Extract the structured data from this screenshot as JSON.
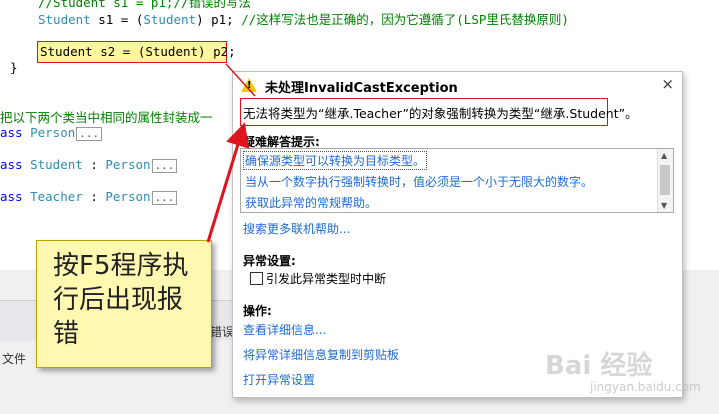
{
  "editor": {
    "line1": {
      "comment": "//Student s1 = p1;//错误的写法"
    },
    "line2": {
      "type1": "Student",
      "mid1": " s1 = (",
      "type2": "Student",
      "mid2": ") p1; ",
      "comment": "//这样写法也是正确的，因为它遵循了(LSP里氏替换原则)"
    },
    "line3": {
      "text": "Student s2 = (Student) p2;"
    },
    "brace": "}",
    "comment_line": "把以下两个类当中相同的属性封装成一",
    "class_person": {
      "kw": "ass",
      "name": "Person",
      "collapsed": "..."
    },
    "class_student": {
      "kw": "ass",
      "name": "Student",
      "sep": " : ",
      "base": "Person",
      "collapsed": "..."
    },
    "class_teacher": {
      "kw": "ass",
      "name": "Teacher",
      "sep": " : ",
      "base": "Person",
      "collapsed": "..."
    }
  },
  "lower_panel": {
    "tab_file": "文件",
    "tab_partial": "错误"
  },
  "exception_popup": {
    "title": "未处理InvalidCastException",
    "close_icon": "×",
    "message": "无法将类型为“继承.Teacher”的对象强制转换为类型“继承.Student”。",
    "tips_label": "疑难解答提示:",
    "tips": [
      "确保源类型可以转换为目标类型。",
      "当从一个数字执行强制转换时，值必须是一个小于无限大的数字。",
      "获取此异常的常规帮助。"
    ],
    "search_link": "搜索更多联机帮助...",
    "settings_label": "异常设置:",
    "checkbox_label": "引发此异常类型时中断",
    "actions_label": "操作:",
    "actions": [
      "查看详细信息...",
      "将异常详细信息复制到剪贴板",
      "打开异常设置"
    ]
  },
  "callout": {
    "text": "按F5程序执行后出现报错"
  },
  "watermark": {
    "main": "Bai 经验",
    "sub": "jingyan.baidu.com"
  },
  "colors": {
    "annotation_red": "#e0141e",
    "callout_bg": "#fff8b0",
    "link_blue": "#1e6bd6",
    "code_teal": "#2b91af",
    "code_green": "#008000"
  }
}
